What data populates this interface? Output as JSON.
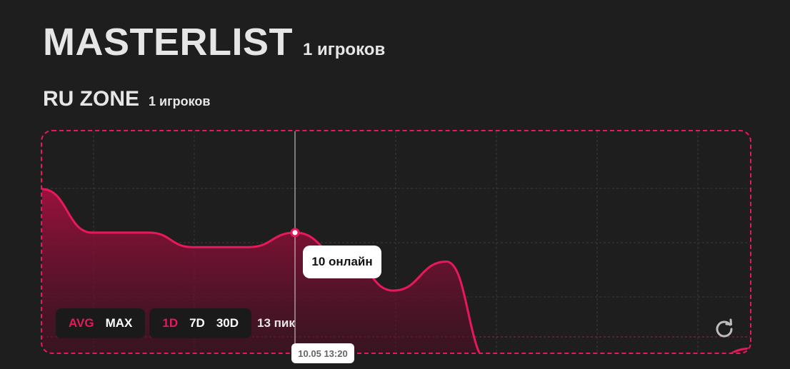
{
  "header": {
    "title": "MASTERLIST",
    "players": "1 игроков"
  },
  "zone": {
    "name": "RU ZONE",
    "players": "1 игроков"
  },
  "controls": {
    "modes": [
      {
        "label": "AVG",
        "active": true
      },
      {
        "label": "MAX",
        "active": false
      }
    ],
    "ranges": [
      {
        "label": "1D",
        "active": true
      },
      {
        "label": "7D",
        "active": false
      },
      {
        "label": "30D",
        "active": false
      }
    ],
    "peak": "13 пик"
  },
  "tooltip": {
    "value": "10 онлайн",
    "time": "10.05 13:20"
  },
  "icons": {
    "refresh": "refresh-icon"
  },
  "colors": {
    "accent": "#e8195a",
    "background": "#1e1e1e"
  },
  "chart_data": {
    "type": "area",
    "ylim": [
      0,
      16
    ],
    "values": [
      13,
      10,
      10,
      9,
      9,
      10,
      8,
      6,
      8,
      1,
      1,
      1,
      1,
      1,
      2
    ],
    "peak": 13,
    "hover": {
      "value": 10,
      "time": "10.05 13:20"
    }
  }
}
